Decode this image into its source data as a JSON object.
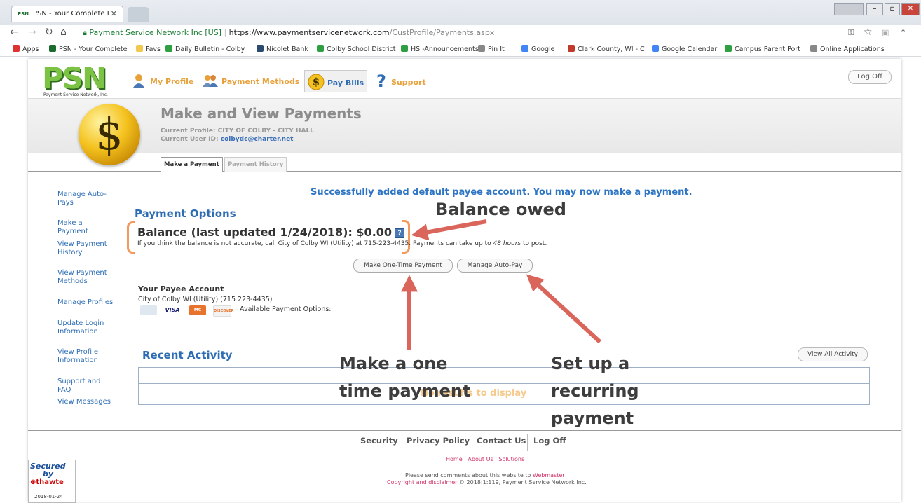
{
  "browser": {
    "tab_title": "PSN - Your Complete P...",
    "tab_favicon": "PSN",
    "url_secure_label": "Payment Service Network Inc [US]",
    "url_host": "https://www.paymentservicenetwork.com",
    "url_path": "/CustProfile/Payments.aspx",
    "bookmarks": [
      {
        "label": "Apps",
        "icon": "apps-icon",
        "color": "#d33"
      },
      {
        "label": "PSN - Your Complete",
        "icon": "psn-favicon",
        "color": "#1a6b2e"
      },
      {
        "label": "Favs",
        "icon": "folder-icon",
        "color": "#f2c94c"
      },
      {
        "label": "Daily Bulletin - Colby",
        "icon": "c-icon",
        "color": "#2ea043"
      },
      {
        "label": "Nicolet Bank",
        "icon": "bank-icon",
        "color": "#2b4a6f"
      },
      {
        "label": "Colby School District",
        "icon": "c-icon",
        "color": "#2ea043"
      },
      {
        "label": "HS -Announcements",
        "icon": "c-icon",
        "color": "#2ea043"
      },
      {
        "label": "Pin It",
        "icon": "page-icon",
        "color": "#888"
      },
      {
        "label": "Google",
        "icon": "google-icon",
        "color": "#4285f4"
      },
      {
        "label": "Clark County, WI - C",
        "icon": "clark-icon",
        "color": "#c0392b"
      },
      {
        "label": "Google Calendar",
        "icon": "calendar-icon",
        "color": "#4285f4"
      },
      {
        "label": "Campus Parent Port",
        "icon": "campus-icon",
        "color": "#2ea043"
      },
      {
        "label": "Online Applications",
        "icon": "apps-arrow-icon",
        "color": "#888"
      }
    ]
  },
  "header": {
    "logo_text": "PSN",
    "logo_subtext": "Payment Service Network, Inc.",
    "nav": [
      {
        "label": "My Profile",
        "icon": "person-icon",
        "color": "#e8a13a"
      },
      {
        "label": "Payment Methods",
        "icon": "people-icon",
        "color": "#e8a13a"
      },
      {
        "label": "Pay Bills",
        "icon": "dollar-coin-icon",
        "color": "#2e6db4"
      },
      {
        "label": "Support",
        "icon": "question-icon",
        "color": "#e8a13a"
      }
    ],
    "logoff_label": "Log Off",
    "page_title": "Make and View Payments",
    "current_profile": "Current Profile: CITY OF COLBY - CITY HALL",
    "current_user_label": "Current User ID:",
    "current_user_value": "colbydc@charter.net",
    "subtabs": [
      "Make a Payment",
      "Payment History"
    ]
  },
  "sidebar": {
    "items": [
      "Manage Auto-Pays",
      "Make a Payment",
      "View Payment History",
      "View Payment Methods",
      "Manage Profiles",
      "Update Login Information",
      "View Profile Information",
      "Support and FAQ",
      "View Messages"
    ]
  },
  "main": {
    "success_message": "Successfully added default payee account. You may now make a payment.",
    "payment_options_title": "Payment Options",
    "balance_text": "Balance (last updated 1/24/2018): $0.00",
    "balance_note_pre": "If you think the balance is not accurate, call City of Colby WI (Utility) at 715-223-4435. Payments can take up to",
    "balance_note_em": "48 hours",
    "balance_note_post": "to post.",
    "btn_one_time": "Make One-Time Payment",
    "btn_autopay": "Manage Auto-Pay",
    "payee_title": "Your Payee Account",
    "payee_line": "City of Colby WI (Utility) (715 223-4435)",
    "cards": [
      "VISA",
      "MC",
      "DISCOVER"
    ],
    "available_options": "Available Payment Options:",
    "recent_title": "Recent Activity",
    "view_all": "View All Activity",
    "no_results": "No results to display"
  },
  "footer": {
    "links": [
      "Security",
      "Privacy Policy",
      "Contact Us",
      "Log Off"
    ],
    "small_links": "Home | About Us | Solutions",
    "comments_pre": "Please send comments about this website to",
    "comments_link": "Webmaster",
    "copyright_link": "Copyright and disclaimer",
    "copyright_rest": "© 2018:1:119, Payment Service Network Inc.",
    "seal_line1": "Secured",
    "seal_line2": "by",
    "seal_line3": "thawte",
    "seal_date": "2018-01-24"
  },
  "annotations": {
    "balance_owed": "Balance owed",
    "one_time_line1": "Make a one",
    "one_time_line2": "time payment",
    "recurring_line1": "Set up a",
    "recurring_line2": "recurring",
    "recurring_line3": "payment",
    "arrow_color": "#d9655b"
  }
}
